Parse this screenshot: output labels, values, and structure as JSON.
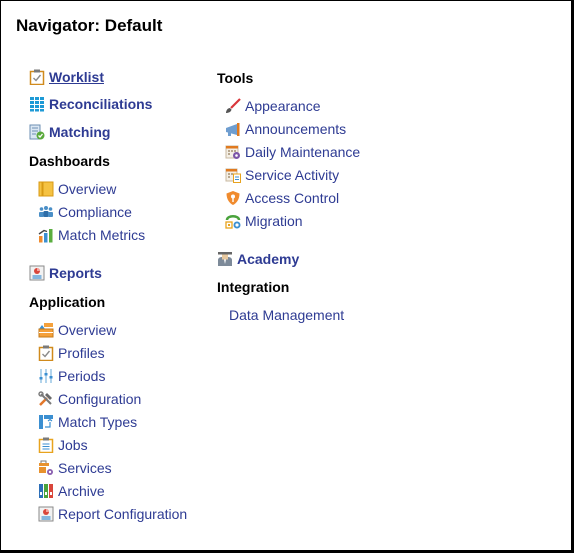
{
  "title": "Navigator: Default",
  "left": {
    "worklist": {
      "label": "Worklist",
      "icon": "clipboard-check-icon"
    },
    "reconciliations": {
      "label": "Reconciliations",
      "icon": "grid-icon"
    },
    "matching": {
      "label": "Matching",
      "icon": "document-check-icon"
    },
    "dashboards": {
      "heading": "Dashboards",
      "items": [
        {
          "label": "Overview",
          "icon": "dashboard-panel-icon"
        },
        {
          "label": "Compliance",
          "icon": "people-group-icon"
        },
        {
          "label": "Match Metrics",
          "icon": "bar-chart-trend-icon"
        }
      ]
    },
    "reports": {
      "label": "Reports",
      "icon": "report-icon"
    },
    "application": {
      "heading": "Application",
      "items": [
        {
          "label": "Overview",
          "icon": "application-overview-icon"
        },
        {
          "label": "Profiles",
          "icon": "clipboard-check-icon"
        },
        {
          "label": "Periods",
          "icon": "sliders-icon"
        },
        {
          "label": "Configuration",
          "icon": "tools-icon"
        },
        {
          "label": "Match Types",
          "icon": "match-types-icon"
        },
        {
          "label": "Jobs",
          "icon": "clipboard-list-icon"
        },
        {
          "label": "Services",
          "icon": "services-gear-icon"
        },
        {
          "label": "Archive",
          "icon": "binders-icon"
        },
        {
          "label": "Report Configuration",
          "icon": "report-icon"
        }
      ]
    }
  },
  "right": {
    "tools": {
      "heading": "Tools",
      "items": [
        {
          "label": "Appearance",
          "icon": "paintbrush-icon"
        },
        {
          "label": "Announcements",
          "icon": "megaphone-icon"
        },
        {
          "label": "Daily Maintenance",
          "icon": "calendar-gear-icon"
        },
        {
          "label": "Service Activity",
          "icon": "calendar-clipboard-icon"
        },
        {
          "label": "Access Control",
          "icon": "shield-key-icon"
        },
        {
          "label": "Migration",
          "icon": "migration-icon"
        }
      ]
    },
    "academy": {
      "label": "Academy",
      "icon": "graduate-icon"
    },
    "integration": {
      "heading": "Integration",
      "items": [
        {
          "label": "Data Management"
        }
      ]
    }
  }
}
